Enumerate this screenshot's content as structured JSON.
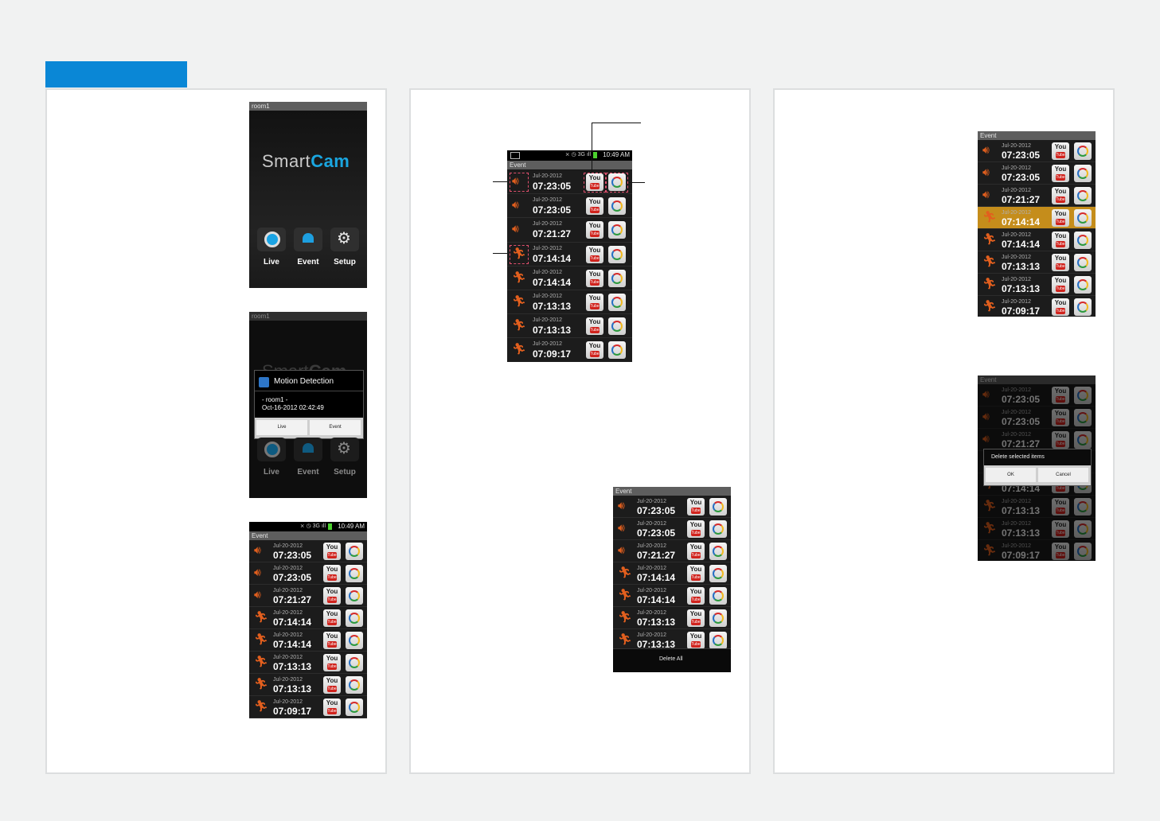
{
  "tab_color": "#0a87d6",
  "splash": {
    "window_title": "room1",
    "logo_smart": "Smart",
    "logo_cam": "Cam",
    "buttons": [
      "Live",
      "Event",
      "Setup"
    ]
  },
  "popup": {
    "window_title": "room1",
    "dialog_title": "Motion Detection",
    "device": "- room1 -",
    "datetime": "Oct-16-2012 02:42:49",
    "live_button": "Live",
    "event_button": "Event",
    "buttons": [
      "Live",
      "Event",
      "Setup"
    ]
  },
  "status_time": "10:49 AM",
  "status_icons": "⨯ ◷ 3G ıll",
  "event_screen_title": "Event",
  "events": [
    {
      "icon": "speaker",
      "date": "Jul-20-2012",
      "time": "07:23:05"
    },
    {
      "icon": "speaker",
      "date": "Jul-20-2012",
      "time": "07:23:05"
    },
    {
      "icon": "speaker",
      "date": "Jul-20-2012",
      "time": "07:21:27"
    },
    {
      "icon": "motion",
      "date": "Jul-20-2012",
      "time": "07:14:14"
    },
    {
      "icon": "motion",
      "date": "Jul-20-2012",
      "time": "07:14:14"
    },
    {
      "icon": "motion",
      "date": "Jul-20-2012",
      "time": "07:13:13"
    },
    {
      "icon": "motion",
      "date": "Jul-20-2012",
      "time": "07:13:13"
    },
    {
      "icon": "motion",
      "date": "Jul-20-2012",
      "time": "07:09:17"
    }
  ],
  "youtube_you": "You",
  "youtube_tube": "Tube",
  "delete_all_label": "Delete All",
  "delete_dialog": {
    "title": "Delete selected items",
    "ok": "OK",
    "cancel": "Cancel"
  }
}
